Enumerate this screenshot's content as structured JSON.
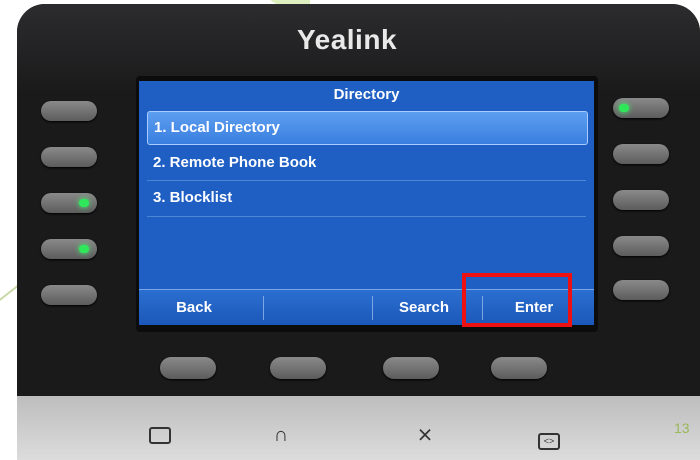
{
  "brand": "Yealink",
  "screen": {
    "title": "Directory",
    "items": [
      {
        "label": "1. Local Directory",
        "selected": true
      },
      {
        "label": "2. Remote Phone Book",
        "selected": false
      },
      {
        "label": "3. Blocklist",
        "selected": false
      }
    ],
    "softkeys": [
      "Back",
      "",
      "Search",
      "Enter"
    ]
  },
  "colors": {
    "screen_bg": "#1f5fc4",
    "highlight": "#ee1111",
    "led": "#2ee85a"
  },
  "bottom_keys": [
    {
      "icon": "message-icon"
    },
    {
      "icon": "headset-icon"
    },
    {
      "icon": "mute-icon"
    },
    {
      "icon": "transfer-icon"
    }
  ],
  "page_number": "13"
}
